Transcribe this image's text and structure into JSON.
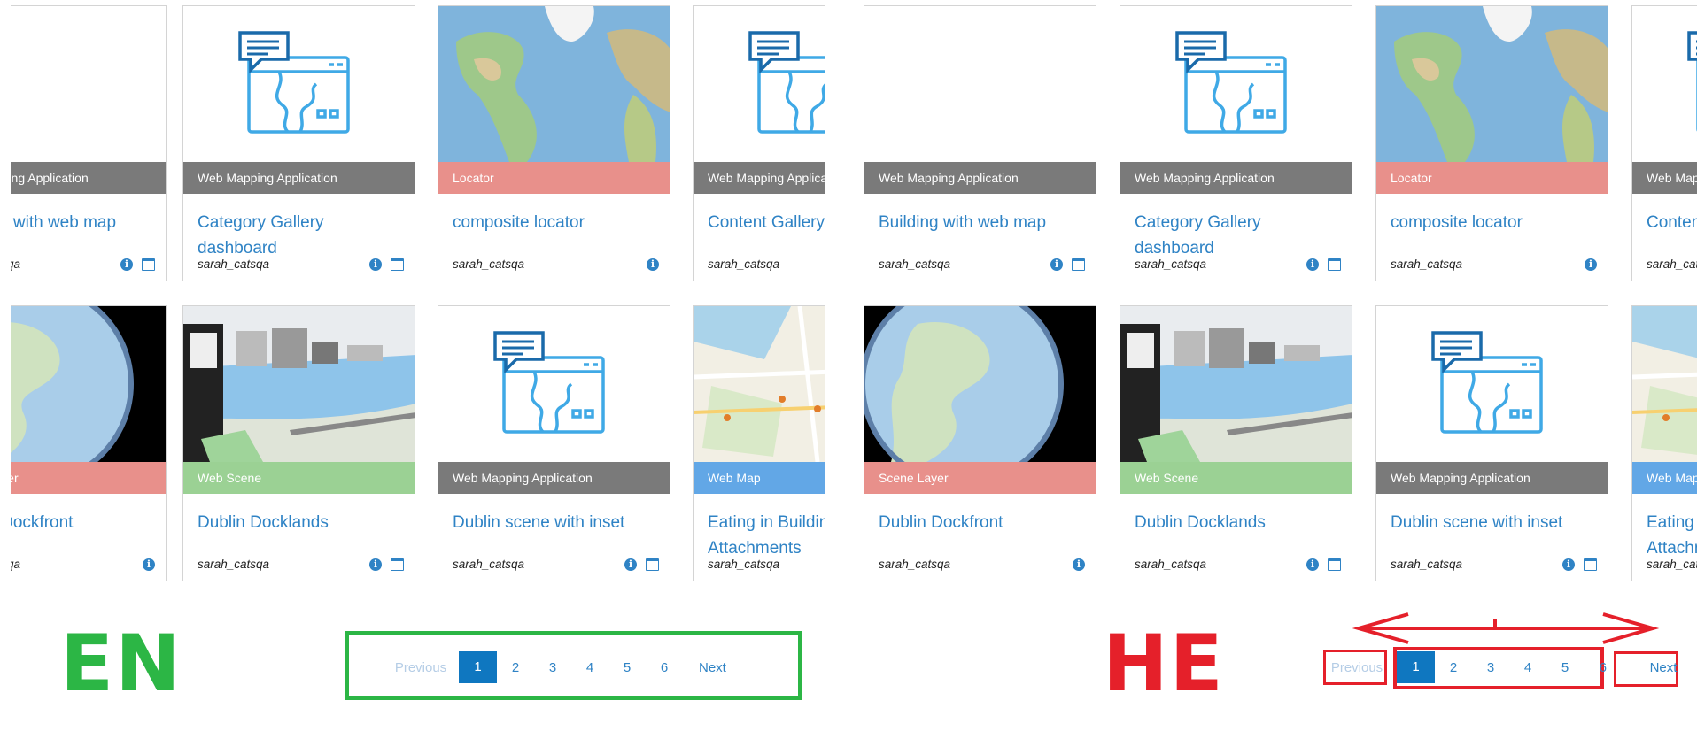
{
  "labels": {
    "en": "EN",
    "he": "HE"
  },
  "colors": {
    "gray": "#7a7a7a",
    "locator": "#e8908b",
    "web_scene": "#9bd194",
    "web_map": "#62a7e6",
    "accent": "#2f83c5",
    "green_box": "#2cb645",
    "red_box": "#e5202a"
  },
  "cards": [
    {
      "type": "Web Mapping Application",
      "title": "Building with web map",
      "owner": "sarah_catsqa",
      "info": true,
      "window": true,
      "thumb": "blank"
    },
    {
      "type": "Web Mapping Application",
      "title": "Category Gallery dashboard",
      "owner": "sarah_catsqa",
      "info": true,
      "window": true,
      "thumb": "app-icon"
    },
    {
      "type": "Locator",
      "title": "composite locator",
      "owner": "sarah_catsqa",
      "info": true,
      "window": false,
      "thumb": "world-map"
    },
    {
      "type": "Web Mapping Application",
      "title": "Content Gallery",
      "owner": "sarah_catsqa",
      "info": true,
      "window": true,
      "thumb": "app-icon"
    },
    {
      "type": "Scene Layer",
      "title": "Dublin Dockfront",
      "owner": "sarah_catsqa",
      "info": true,
      "window": false,
      "thumb": "globe"
    },
    {
      "type": "Web Scene",
      "title": "Dublin Docklands",
      "owner": "sarah_catsqa",
      "info": true,
      "window": true,
      "thumb": "city"
    },
    {
      "type": "Web Mapping Application",
      "title": "Dublin scene with inset",
      "owner": "sarah_catsqa",
      "info": true,
      "window": true,
      "thumb": "app-icon"
    },
    {
      "type": "Web Map",
      "title": "Eating in Building Attachments",
      "owner": "sarah_catsqa",
      "info": true,
      "window": true,
      "thumb": "street-map"
    }
  ],
  "pagination": {
    "previous": "Previous",
    "next": "Next",
    "pages": [
      "1",
      "2",
      "3",
      "4",
      "5",
      "6"
    ],
    "current": "1"
  }
}
